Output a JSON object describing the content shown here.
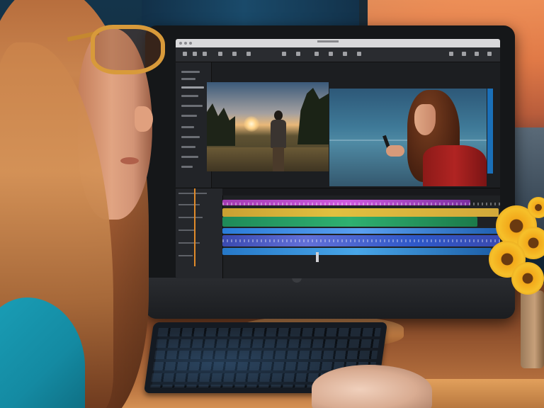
{
  "scene": {
    "kind": "photo",
    "elements": [
      "woman-with-glasses",
      "desktop-monitor",
      "video-editing-software",
      "keyboard",
      "hand-on-keyboard",
      "sunflowers",
      "sunset-window"
    ]
  },
  "screen": {
    "app": "video-editor",
    "viewer_left": "silhouette-in-field-at-sunset",
    "viewer_right": "woman-with-phone-by-lake",
    "timeline_track_colors": [
      "#c24fd4",
      "#d7b53a",
      "#28a065",
      "#4a8fe8",
      "#4b5cc8",
      "#3a90d8"
    ]
  },
  "colors": {
    "sunset": "#e8844a",
    "playhead": "#e08a2a",
    "accent_blue": "#1a6fb8",
    "flower": "#f6c02a",
    "shirt": "#148aa2"
  }
}
